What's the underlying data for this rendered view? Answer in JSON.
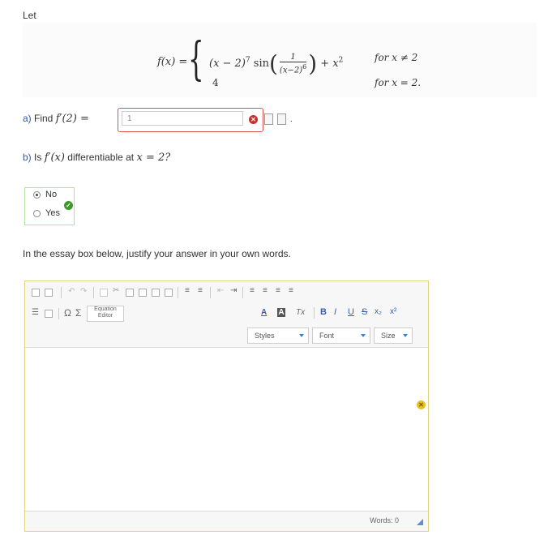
{
  "intro": "Let",
  "function": {
    "lhs": "f(x) =",
    "case1_base": "(x − 2)",
    "case1_exp": "7",
    "case1_sin": "sin",
    "frac_num": "1",
    "frac_den": "(x−2)",
    "frac_den_exp": "6",
    "case1_tail": "+ x",
    "case1_tail_exp": "2",
    "case1_cond": "for x ≠ 2",
    "case2_value": "4",
    "case2_cond": "for x = 2."
  },
  "part_a": {
    "label": "a)",
    "text": "Find",
    "expr": "f′(2) =",
    "answer_value": "1",
    "status": "incorrect",
    "trailing": "."
  },
  "part_b": {
    "label": "b)",
    "text": "Is",
    "expr": "f′(x)",
    "text2": "differentiable at",
    "expr2": "x = 2?",
    "options": [
      "No",
      "Yes"
    ],
    "selected": "No",
    "status": "correct"
  },
  "essay": {
    "prompt": "In the essay box below, justify your answer in your own words.",
    "equation_editor_label_1": "Equation",
    "equation_editor_label_2": "Editor",
    "styles_label": "Styles",
    "font_label": "Font",
    "size_label": "Size",
    "word_count": "Words: 0",
    "format_buttons": [
      "B",
      "I",
      "U",
      "S",
      "x₂",
      "x²"
    ],
    "text_color_label": "A",
    "bg_color_label": "A",
    "clear_format_label": "Tx",
    "status": "warning"
  },
  "colors": {
    "accent_blue": "#2a56b6",
    "error_red": "#c9302c",
    "correct_green": "#3c9a2a",
    "warning_yellow": "#e8c020",
    "editor_border": "#e0d47a"
  }
}
